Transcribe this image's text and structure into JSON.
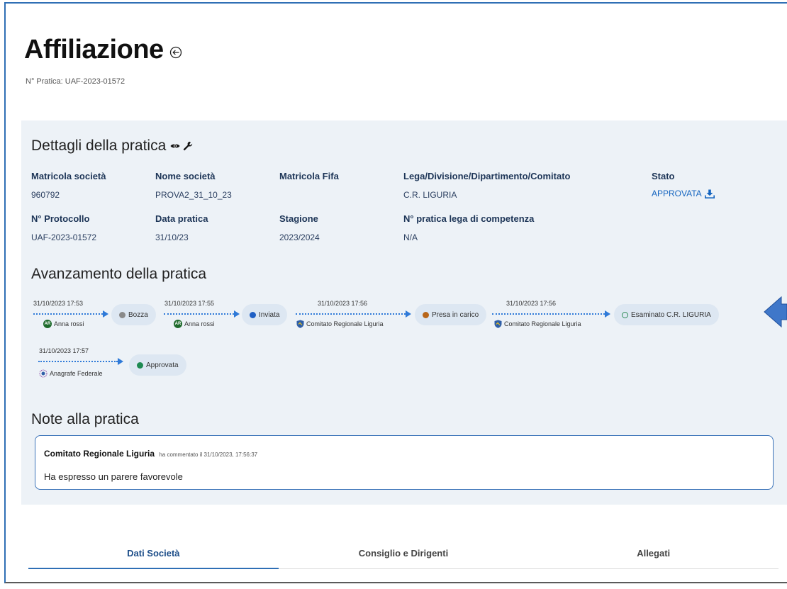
{
  "header": {
    "title": "Affiliazione",
    "pratica_label": "N° Pratica: UAF-2023-01572"
  },
  "details": {
    "heading": "Dettagli della pratica",
    "fields": [
      {
        "label": "Matricola società",
        "value": "960792"
      },
      {
        "label": "Nome società",
        "value": "PROVA2_31_10_23"
      },
      {
        "label": "Matricola Fifa",
        "value": ""
      },
      {
        "label": "Lega/Divisione/Dipartimento/Comitato",
        "value": "C.R. LIGURIA"
      },
      {
        "label": "Stato",
        "value": "APPROVATA"
      },
      {
        "label": "N° Protocollo",
        "value": "UAF-2023-01572"
      },
      {
        "label": "Data pratica",
        "value": "31/10/23"
      },
      {
        "label": "Stagione",
        "value": "2023/2024"
      },
      {
        "label": "N° pratica lega di competenza",
        "value": "N/A"
      }
    ]
  },
  "progress": {
    "heading": "Avanzamento della pratica",
    "steps": [
      {
        "date": "31/10/2023 17:53",
        "actor": "Anna rossi",
        "actor_initials": "AR",
        "status": "Bozza",
        "status_color": "#8a8a8a"
      },
      {
        "date": "31/10/2023 17:55",
        "actor": "Anna rossi",
        "actor_initials": "AR",
        "status": "Inviata",
        "status_color": "#1f5fc4"
      },
      {
        "date": "31/10/2023 17:56",
        "actor": "Comitato Regionale Liguria",
        "status": "Presa in carico",
        "status_color": "#b8661a"
      },
      {
        "date": "31/10/2023 17:56",
        "actor": "Comitato Regionale Liguria",
        "status": "Esaminato C.R. LIGURIA",
        "status_color": "#2e8b57"
      },
      {
        "date": "31/10/2023 17:57",
        "actor": "Anagrafe Federale",
        "status": "Approvata",
        "status_color": "#1e8a52"
      }
    ]
  },
  "notes": {
    "heading": "Note alla pratica",
    "items": [
      {
        "author": "Comitato Regionale Liguria",
        "meta": "ha commentato il 31/10/2023, 17:56:37",
        "text": "Ha espresso un parere favorevole"
      }
    ]
  },
  "tabs": [
    "Dati Società",
    "Consiglio e Dirigenti",
    "Allegati"
  ],
  "colors": {
    "accent": "#2f6fb5",
    "panel_bg": "#edf2f7",
    "stato": "#1565c0"
  },
  "icons": [
    "back-circle-icon",
    "eye-icon",
    "wrench-icon",
    "download-icon",
    "arrow-left-icon"
  ]
}
